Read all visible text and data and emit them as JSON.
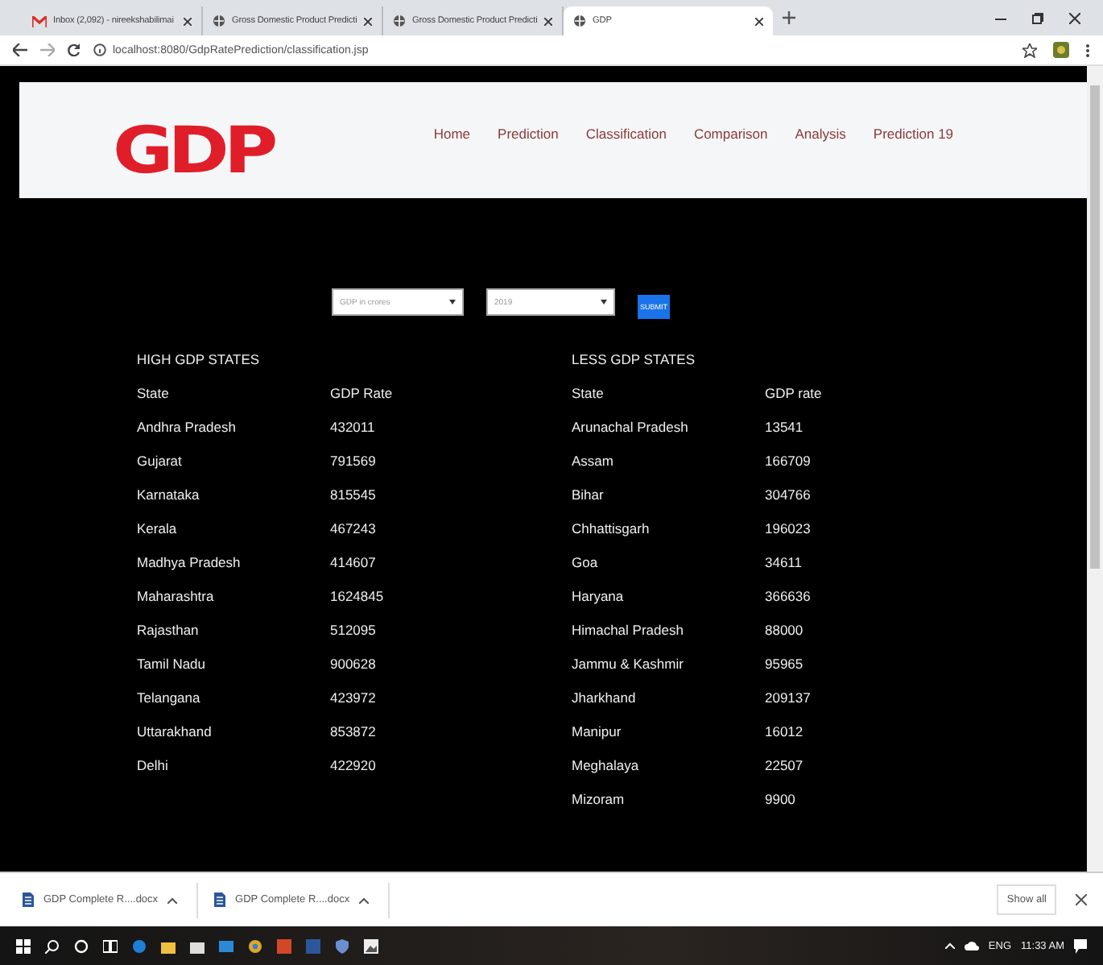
{
  "browser": {
    "tabs": [
      {
        "title": "Inbox (2,092) - nireekshabilimai",
        "kind": "mail",
        "selected": false
      },
      {
        "title": "Gross Domestic Product Predicti",
        "kind": "web",
        "selected": false
      },
      {
        "title": "Gross Domestic Product Predicti",
        "kind": "web",
        "selected": false
      },
      {
        "title": "GDP",
        "kind": "web",
        "selected": true
      }
    ],
    "address": "localhost:8080/GdpRatePrediction/classification.jsp"
  },
  "header": {
    "logo": "GDP",
    "nav": [
      "Home",
      "Prediction",
      "Classification",
      "Comparison",
      "Analysis",
      "Prediction 19"
    ]
  },
  "form": {
    "measure": "GDP in crores",
    "year": "2019",
    "submit": "SUBMIT"
  },
  "tables": [
    {
      "title": "HIGH GDP STATES",
      "columns": [
        "State",
        "GDP Rate"
      ],
      "rows": [
        [
          "Andhra Pradesh",
          "432011"
        ],
        [
          "Gujarat",
          "791569"
        ],
        [
          "Karnataka",
          "815545"
        ],
        [
          "Kerala",
          "467243"
        ],
        [
          "Madhya Pradesh",
          "414607"
        ],
        [
          "Maharashtra",
          "1624845"
        ],
        [
          "Rajasthan",
          "512095"
        ],
        [
          "Tamil Nadu",
          "900628"
        ],
        [
          "Telangana",
          "423972"
        ],
        [
          "Uttarakhand",
          "853872"
        ],
        [
          "Delhi",
          "422920"
        ]
      ]
    },
    {
      "title": "LESS GDP STATES",
      "columns": [
        "State",
        "GDP rate"
      ],
      "rows": [
        [
          "Arunachal Pradesh",
          "13541"
        ],
        [
          "Assam",
          "166709"
        ],
        [
          "Bihar",
          "304766"
        ],
        [
          "Chhattisgarh",
          "196023"
        ],
        [
          "Goa",
          "34611"
        ],
        [
          "Haryana",
          "366636"
        ],
        [
          "Himachal Pradesh",
          "88000"
        ],
        [
          "Jammu & Kashmir",
          "95965"
        ],
        [
          "Jharkhand",
          "209137"
        ],
        [
          "Manipur",
          "16012"
        ],
        [
          "Meghalaya",
          "22507"
        ],
        [
          "Mizoram",
          "9900"
        ]
      ]
    }
  ],
  "downloads": {
    "items": [
      "GDP Complete R....docx",
      "GDP Complete R....docx"
    ],
    "show_all": "Show all"
  },
  "taskbar": {
    "language": "ENG",
    "time": "11:33 AM"
  }
}
